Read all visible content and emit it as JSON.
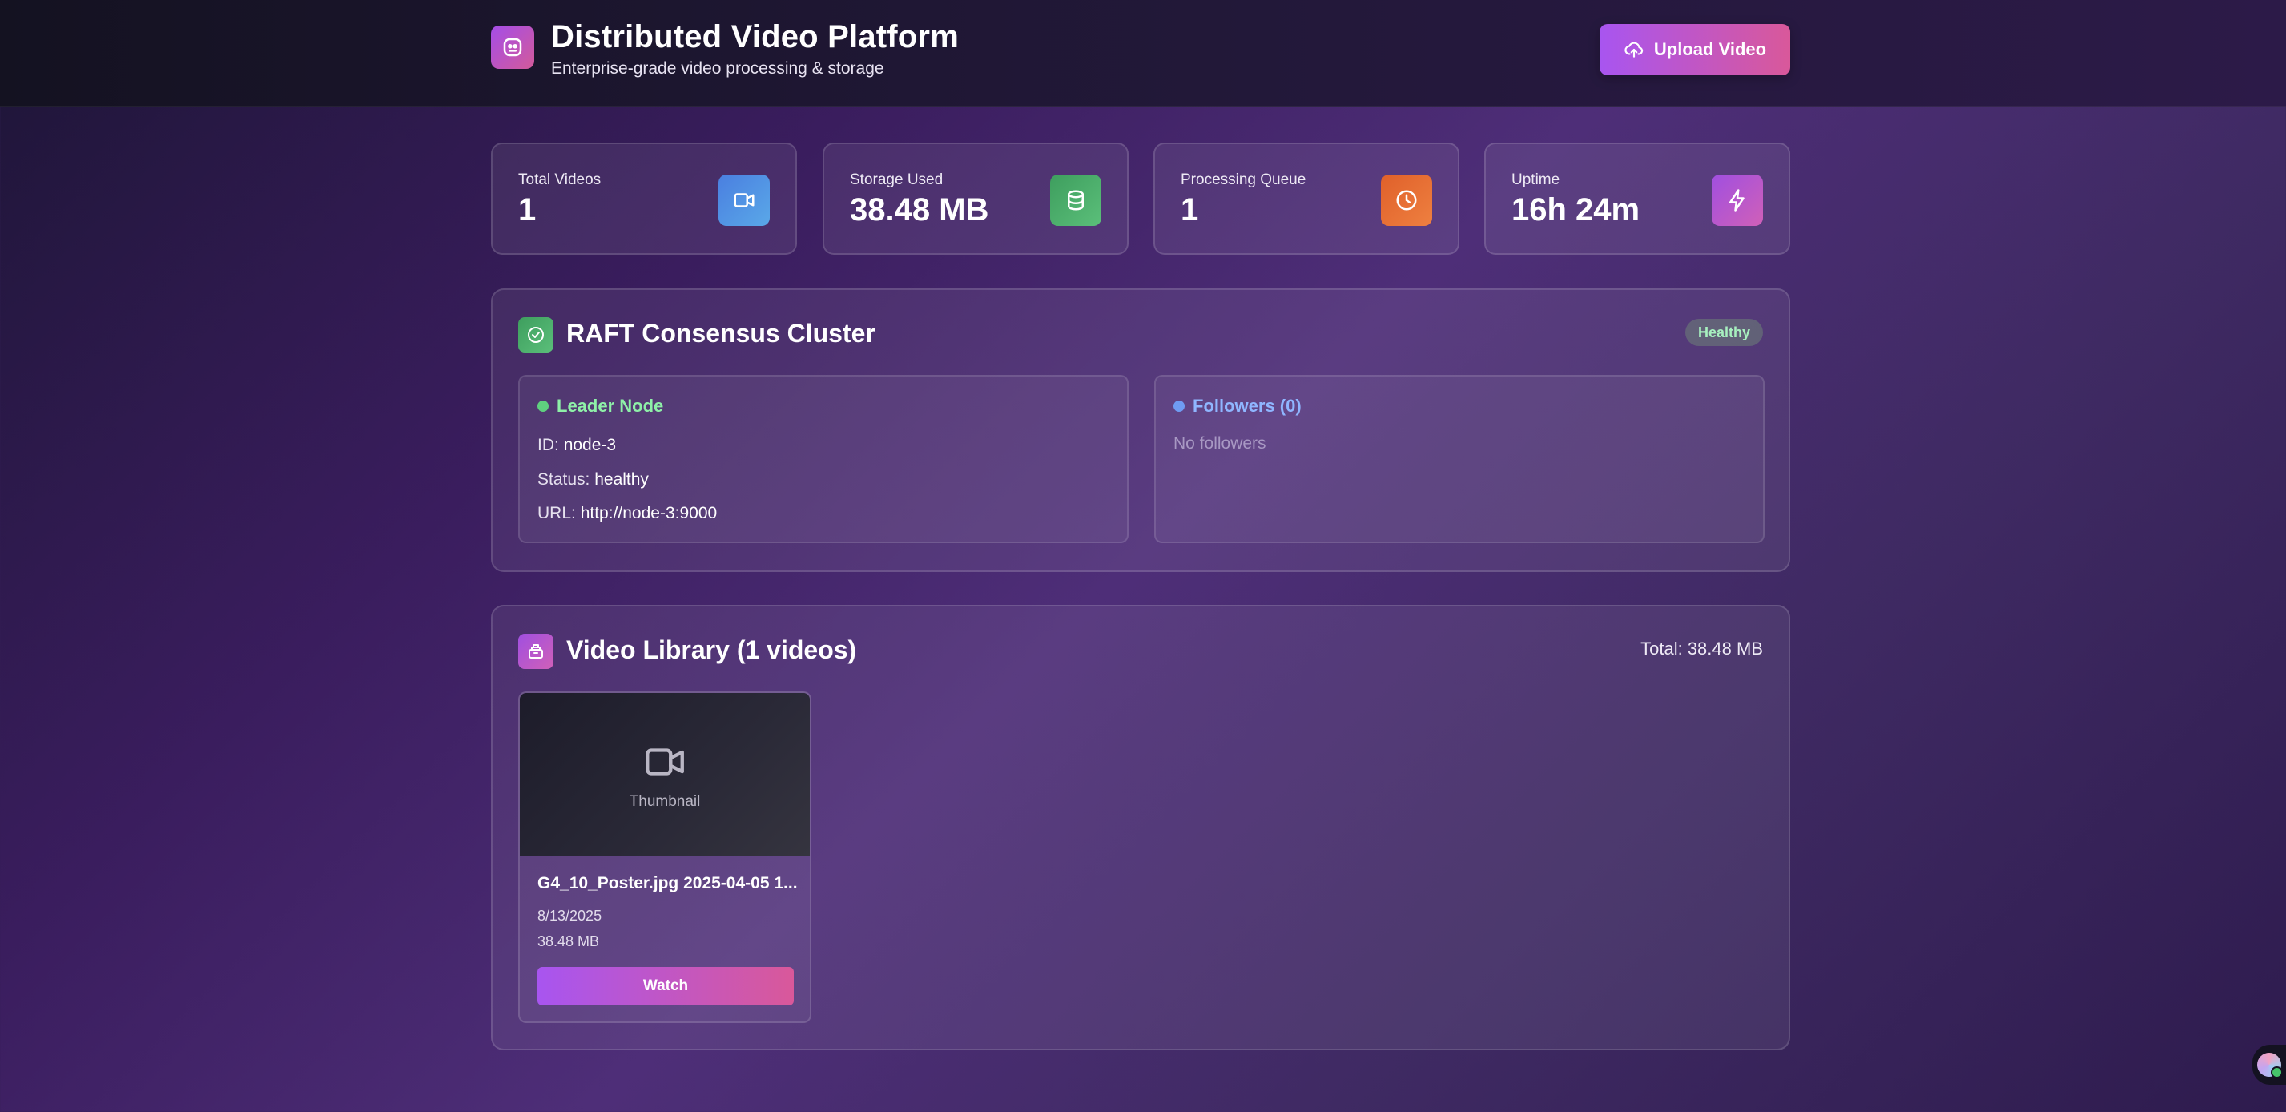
{
  "app": {
    "title": "Distributed Video Platform",
    "subtitle": "Enterprise-grade video processing & storage",
    "upload_label": "Upload Video",
    "logo_icon": "dashboard-logo-icon",
    "accent_gradient": [
      "#a855f0",
      "#d9589a"
    ]
  },
  "stats": [
    {
      "label": "Total Videos",
      "value": "1",
      "icon": "video-camera-icon",
      "color": "#4f8fe0"
    },
    {
      "label": "Storage Used",
      "value": "38.48 MB",
      "icon": "database-icon",
      "color": "#43a867"
    },
    {
      "label": "Processing Queue",
      "value": "1",
      "icon": "clock-icon",
      "color": "#e66a2c"
    },
    {
      "label": "Uptime",
      "value": "16h 24m",
      "icon": "lightning-icon",
      "color": "#b65ad8"
    }
  ],
  "cluster": {
    "title": "RAFT Consensus Cluster",
    "status_badge": "Healthy",
    "leader": {
      "heading": "Leader Node",
      "id_label": "ID:",
      "id_value": "node-3",
      "status_label": "Status:",
      "status_value": "healthy",
      "url_label": "URL:",
      "url_value": "http://node-3:9000"
    },
    "followers": {
      "heading": "Followers (0)",
      "empty_text": "No followers"
    }
  },
  "library": {
    "title": "Video Library (1 videos)",
    "total": "Total: 38.48 MB",
    "videos": [
      {
        "thumbnail_label": "Thumbnail",
        "title": "G4_10_Poster.jpg 2025-04-05 1...",
        "date": "8/13/2025",
        "size": "38.48 MB",
        "action": "Watch"
      }
    ]
  }
}
